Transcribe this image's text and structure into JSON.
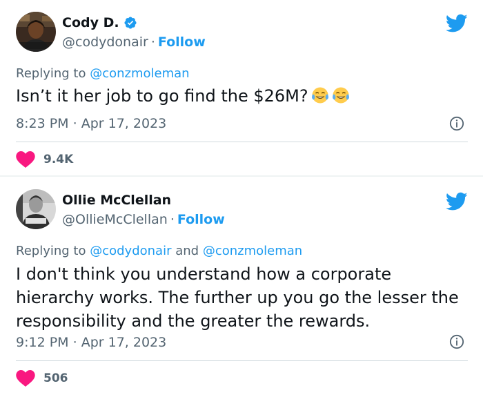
{
  "tweets": [
    {
      "name": "Cody D.",
      "verified": true,
      "handle": "@codydonair",
      "dot": "·",
      "follow_label": "Follow",
      "replying_prefix": "Replying to",
      "replying_to_1": "@conzmoleman",
      "replying_and": "",
      "replying_to_2": "",
      "text": "Isn’t it her job to go find the $26M?",
      "emoji": [
        "face-with-tears-of-joy-icon",
        "face-with-tears-of-joy-icon"
      ],
      "time": "8:23 PM",
      "date": "Apr 17, 2023",
      "likes": "9.4K"
    },
    {
      "name": "Ollie McClellan",
      "verified": false,
      "handle": "@OllieMcClellan",
      "dot": "·",
      "follow_label": "Follow",
      "replying_prefix": "Replying to",
      "replying_to_1": "@codydonair",
      "replying_and": "and",
      "replying_to_2": "@conzmoleman",
      "text": "I don't think you understand how a corporate hierarchy works. The further up you go the lesser the responsibility and the greater the rewards.",
      "time": "9:12 PM",
      "date": "Apr 17, 2023",
      "likes": "506"
    }
  ],
  "colors": {
    "brand_blue": "#1d9bf0",
    "heart_red": "#f91880",
    "text_primary": "#0f1419",
    "text_secondary": "#536471"
  }
}
